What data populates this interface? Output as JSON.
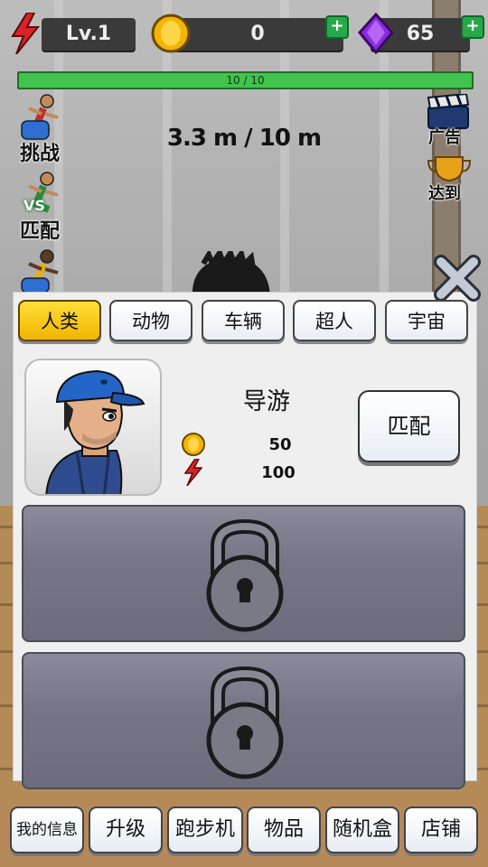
{
  "hud": {
    "level": "Lv.1",
    "coins": "0",
    "gems": "65",
    "plus_coin": "+",
    "plus_gem": "+"
  },
  "progress": {
    "text": "10 / 10",
    "fraction": 1.0
  },
  "distance": "3.3 m / 10 m",
  "left_menu": {
    "challenge": "挑战",
    "versus": "VS",
    "match": "匹配"
  },
  "right_menu": {
    "ad": "广告",
    "achievement": "达到"
  },
  "tabs": [
    {
      "label": "人类",
      "active": true
    },
    {
      "label": "动物",
      "active": false
    },
    {
      "label": "车辆",
      "active": false
    },
    {
      "label": "超人",
      "active": false
    },
    {
      "label": "宇宙",
      "active": false
    }
  ],
  "character": {
    "name": "导游",
    "coin_cost": "50",
    "energy_cost": "100",
    "match_label": "匹配"
  },
  "bottom_nav": [
    {
      "label": "我的信息"
    },
    {
      "label": "升级"
    },
    {
      "label": "跑步机"
    },
    {
      "label": "物品"
    },
    {
      "label": "随机盒"
    },
    {
      "label": "店铺"
    }
  ],
  "icons": {
    "energy": "lightning-icon",
    "coin": "coin-icon",
    "gem": "gem-icon",
    "lock": "lock-icon",
    "close": "close-icon",
    "ad": "clapperboard-icon",
    "trophy": "trophy-icon"
  },
  "colors": {
    "accent_yellow": "#f2b400",
    "progress_green": "#42c24e",
    "energy_red": "#d8232a",
    "gem_purple": "#8a2be2"
  }
}
